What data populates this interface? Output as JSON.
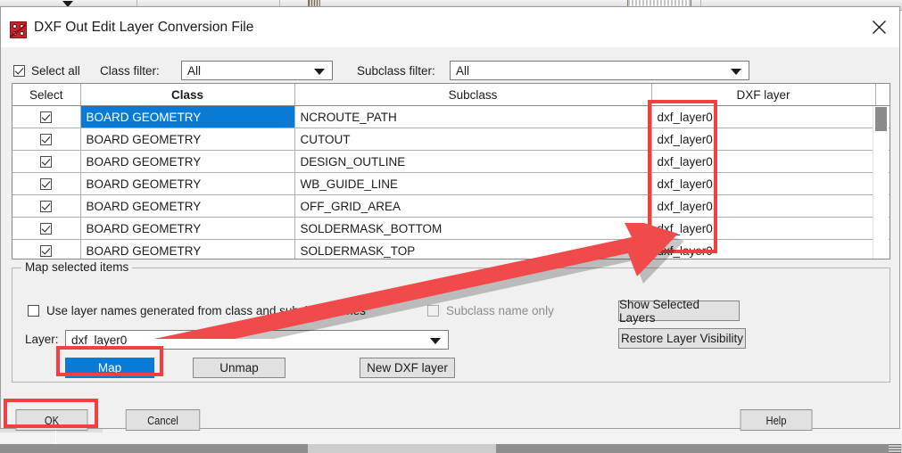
{
  "window": {
    "title": "DXF Out Edit Layer Conversion File",
    "app_icon": "dxf-dice-icon",
    "close_icon": "close-icon"
  },
  "filters": {
    "select_all_label": "Select all",
    "select_all_checked": true,
    "class_filter_label": "Class filter:",
    "class_filter_value": "All",
    "subclass_filter_label": "Subclass filter:",
    "subclass_filter_value": "All"
  },
  "table": {
    "headers": [
      "Select",
      "Class",
      "Subclass",
      "DXF layer"
    ],
    "rows": [
      {
        "checked": true,
        "class": "BOARD GEOMETRY",
        "subclass": "NCROUTE_PATH",
        "dxf_layer": "dxf_layer0",
        "selected": true
      },
      {
        "checked": true,
        "class": "BOARD GEOMETRY",
        "subclass": "CUTOUT",
        "dxf_layer": "dxf_layer0",
        "selected": false
      },
      {
        "checked": true,
        "class": "BOARD GEOMETRY",
        "subclass": "DESIGN_OUTLINE",
        "dxf_layer": "dxf_layer0",
        "selected": false
      },
      {
        "checked": true,
        "class": "BOARD GEOMETRY",
        "subclass": "WB_GUIDE_LINE",
        "dxf_layer": "dxf_layer0",
        "selected": false
      },
      {
        "checked": true,
        "class": "BOARD GEOMETRY",
        "subclass": "OFF_GRID_AREA",
        "dxf_layer": "dxf_layer0",
        "selected": false
      },
      {
        "checked": true,
        "class": "BOARD GEOMETRY",
        "subclass": "SOLDERMASK_BOTTOM",
        "dxf_layer": "dxf_layer0",
        "selected": false
      },
      {
        "checked": true,
        "class": "BOARD GEOMETRY",
        "subclass": "SOLDERMASK_TOP",
        "dxf_layer": "dxf_layer0",
        "selected": false
      }
    ]
  },
  "map_group": {
    "title": "Map selected items",
    "use_layer_names_label": "Use layer names generated from class and subclass names",
    "use_layer_names_checked": false,
    "subclass_name_only_label": "Subclass name only",
    "subclass_name_only_checked": false,
    "subclass_name_only_disabled": true,
    "layer_label": "Layer:",
    "layer_value": "dxf_layer0",
    "map_button": "Map",
    "unmap_button": "Unmap",
    "new_dxf_layer_button": "New DXF layer",
    "show_selected_layers_button": "Show Selected Layers",
    "restore_layer_visibility_button": "Restore Layer Visibility"
  },
  "footer": {
    "ok_button": "OK",
    "cancel_button": "Cancel",
    "help_button": "Help"
  },
  "colors": {
    "selection_blue": "#0a7bd4",
    "annotation_red": "#f04040",
    "dialog_bg": "#f0f0f0",
    "button_bg": "#e1e1e1"
  }
}
